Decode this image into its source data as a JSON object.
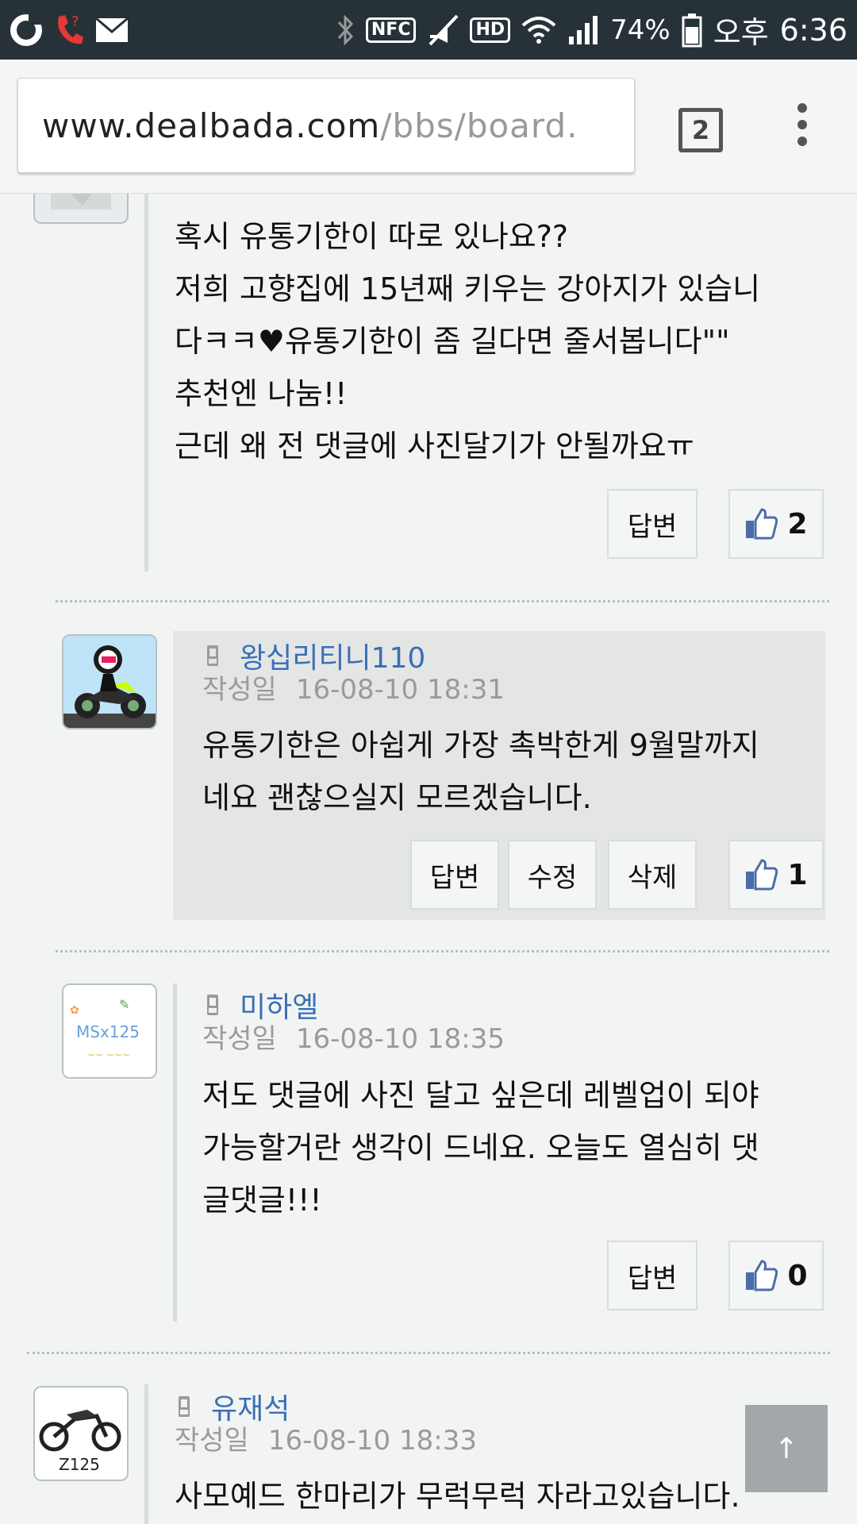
{
  "status_bar": {
    "nfc": "NFC",
    "hd": "HD",
    "battery": "74%",
    "ampm": "오후",
    "time": "6:36",
    "icons": [
      "carrier-o-icon",
      "missed-call-icon",
      "mail-icon",
      "bluetooth-icon",
      "nfc-icon",
      "mute-icon",
      "hd-icon",
      "wifi-icon",
      "signal-icon",
      "battery-icon"
    ]
  },
  "browser": {
    "url_host": "www.dealbada.com",
    "url_path": "/bbs/board.",
    "tab_count": "2"
  },
  "comments": [
    {
      "lines": [
        "혹시 유통기한이 따로 있나요??",
        "저희 고향집에 15년째 키우는 강아지가 있습니",
        "다ㅋㅋ♥유통기한이 좀 길다면 줄서봅니다\"\"",
        "추천엔 나눔!!",
        "근데 왜 전 댓글에 사진달기가 안될까요ㅠ"
      ],
      "reply_label": "답변",
      "likes": "2"
    },
    {
      "author": "왕십리티니110",
      "date_label": "작성일",
      "date": "16-08-10 18:31",
      "lines": [
        "유통기한은 아쉽게 가장 촉박한게 9월말까지",
        "네요 괜찮으실지 모르겠습니다."
      ],
      "reply_label": "답변",
      "edit_label": "수정",
      "delete_label": "삭제",
      "likes": "1"
    },
    {
      "author": "미하엘",
      "date_label": "작성일",
      "date": "16-08-10 18:35",
      "lines": [
        "저도 댓글에 사진 달고 싶은데 레벨업이 되야",
        "가능할거란 생각이 드네요. 오늘도 열심히 댓",
        "글댓글!!!"
      ],
      "reply_label": "답변",
      "likes": "0",
      "avatar_text": "MSx125"
    },
    {
      "author": "유재석",
      "date_label": "작성일",
      "date": "16-08-10 18:33",
      "lines": [
        "사모예드 한마리가 무럭무럭 자라고있습니다."
      ],
      "avatar_text": "Z125"
    }
  ],
  "scroll_top_label": "↑",
  "colors": {
    "author": "#3a6fb4",
    "status_bar": "#263238",
    "like_icon": "#4a6ea8"
  }
}
